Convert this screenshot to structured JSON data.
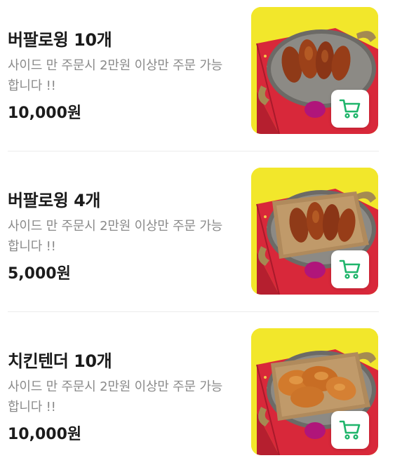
{
  "menu": {
    "items": [
      {
        "name": "버팔로윙 10개",
        "description": "사이드 만 주문시 2만원 이상만 주문 가능합니다 !!",
        "price": "10,000원",
        "food": "wings",
        "cart_icon": "cart-icon"
      },
      {
        "name": "버팔로윙 4개",
        "description": "사이드 만 주문시 2만원 이상만 주문 가능합니다 !!",
        "price": "5,000원",
        "food": "wings",
        "cart_icon": "cart-icon"
      },
      {
        "name": "치킨텐더 10개",
        "description": "사이드 만 주문시 2만원 이상만 주문 가능합니다 !!",
        "price": "10,000원",
        "food": "tenders",
        "cart_icon": "cart-icon"
      }
    ]
  },
  "colors": {
    "thumb_background": "#f2e72b",
    "box_red": "#d8283a",
    "cart_green": "#1fb56b",
    "name_text": "#1b1b1b",
    "desc_text": "#8a8a8a"
  }
}
